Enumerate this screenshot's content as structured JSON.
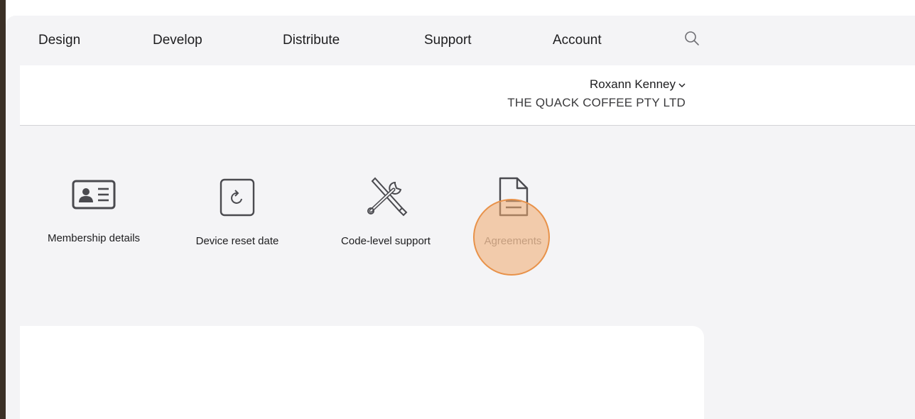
{
  "nav": {
    "items": [
      {
        "label": "Design"
      },
      {
        "label": "Develop"
      },
      {
        "label": "Distribute"
      },
      {
        "label": "Support"
      },
      {
        "label": "Account"
      }
    ],
    "search_icon": "search-icon"
  },
  "account": {
    "user_name": "Roxann Kenney",
    "org_name": "THE QUACK COFFEE PTY LTD"
  },
  "tiles": [
    {
      "label": "Membership details",
      "icon": "id-card-icon"
    },
    {
      "label": "Device reset date",
      "icon": "device-reset-icon"
    },
    {
      "label": "Code-level support",
      "icon": "tools-icon"
    },
    {
      "label": "Agreements",
      "icon": "document-icon"
    }
  ],
  "colors": {
    "nav_background": "#f4f4f6",
    "text": "#1d1d1f",
    "icon": "#6e6e73",
    "cursor_highlight": "#e8924a"
  }
}
